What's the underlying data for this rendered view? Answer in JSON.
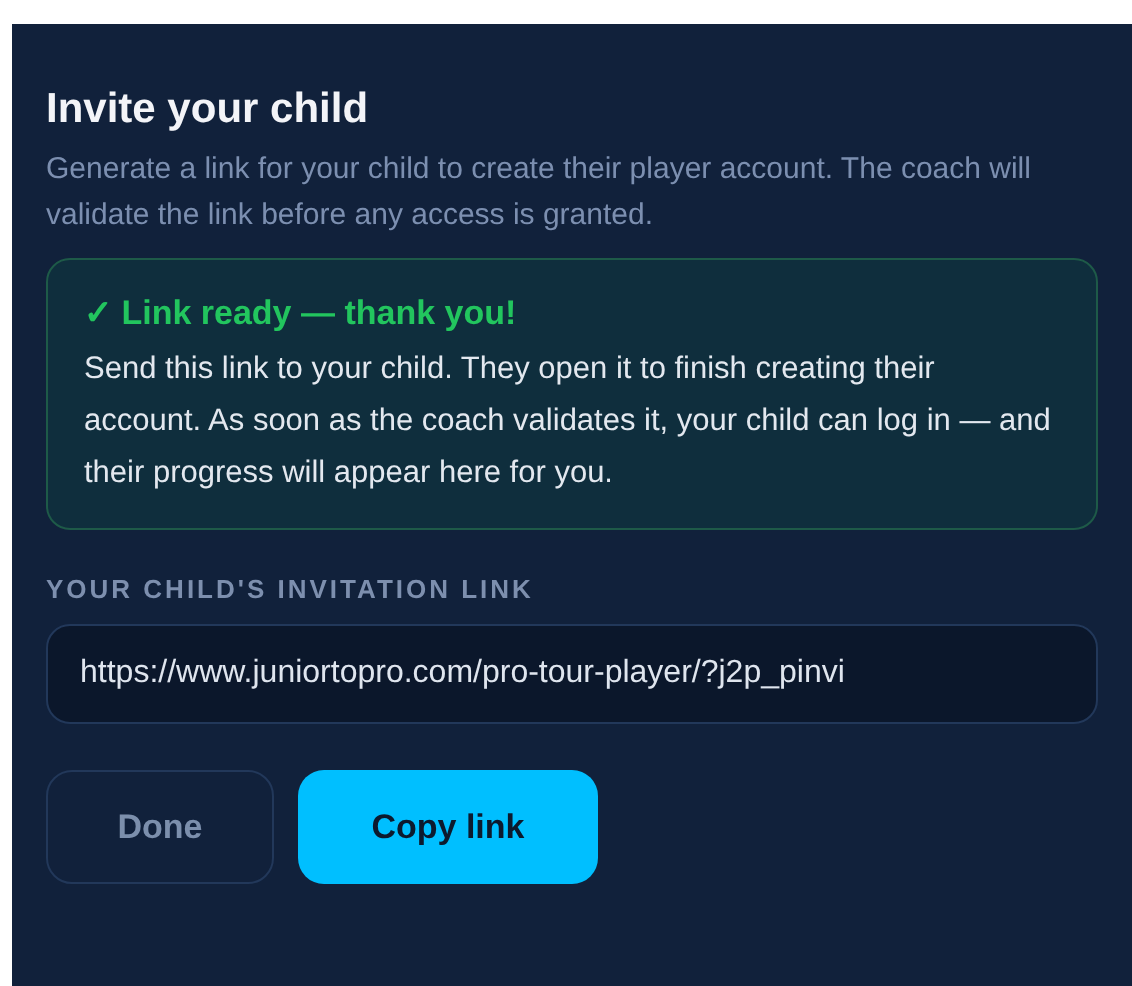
{
  "dialog": {
    "title": "Invite your child",
    "subtitle": "Generate a link for your child to create their player account. The coach will validate the link before any access is granted.",
    "notice": {
      "title": "✓ Link ready — thank you!",
      "text": "Send this link to your child. They open it to finish creating their account. As soon as the coach validates it, your child can log in — and their progress will appear here for you."
    },
    "link_field": {
      "label": "YOUR CHILD'S INVITATION LINK",
      "value": "https://www.juniortopro.com/pro-tour-player/?j2p_pinvi"
    },
    "buttons": [
      {
        "label": "Done",
        "kind": "secondary"
      },
      {
        "label": "Copy link",
        "kind": "primary"
      }
    ]
  }
}
